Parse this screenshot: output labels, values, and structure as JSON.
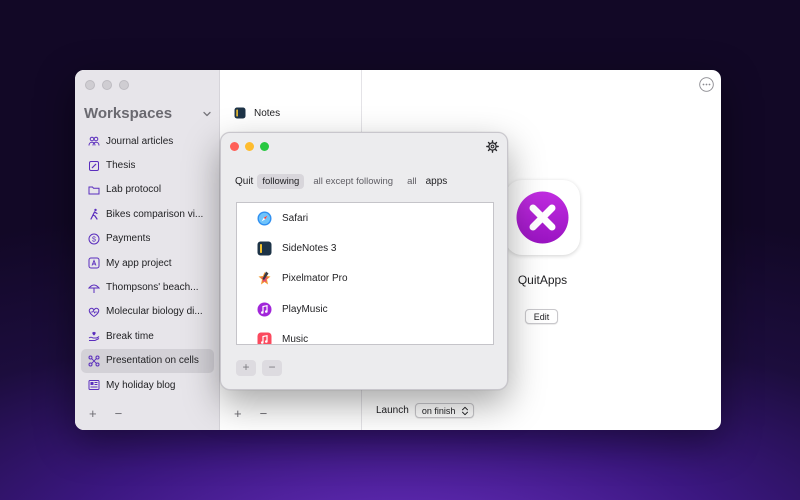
{
  "sidebar": {
    "title": "Workspaces",
    "items": [
      {
        "label": "Journal articles",
        "icon": "people-icon"
      },
      {
        "label": "Thesis",
        "icon": "pencil-square-icon"
      },
      {
        "label": "Lab protocol",
        "icon": "folder-icon"
      },
      {
        "label": "Bikes comparison vi...",
        "icon": "cyclist-icon"
      },
      {
        "label": "Payments",
        "icon": "dollar-circle-icon"
      },
      {
        "label": "My app project",
        "icon": "app-store-icon"
      },
      {
        "label": "Thompsons' beach...",
        "icon": "beach-umbrella-icon"
      },
      {
        "label": "Molecular biology di...",
        "icon": "heart-pulse-icon"
      },
      {
        "label": "Break time",
        "icon": "hand-heart-icon"
      },
      {
        "label": "Presentation on cells",
        "icon": "network-icon",
        "selected": true
      },
      {
        "label": "My holiday blog",
        "icon": "newspaper-icon"
      }
    ],
    "add_label": "+",
    "remove_label": "−"
  },
  "middle": {
    "notes_label": "Notes",
    "add_label": "+",
    "remove_label": "−"
  },
  "detail": {
    "app_name": "QuitApps",
    "edit_label": "Edit",
    "launch_label": "Launch",
    "launch_value": "on finish"
  },
  "popover": {
    "quit_label": "Quit",
    "segments": [
      "following",
      "all except following",
      "all"
    ],
    "apps_label": "apps",
    "apps": [
      {
        "name": "Safari",
        "icon": "safari-icon"
      },
      {
        "name": "SideNotes 3",
        "icon": "sidenotes-icon"
      },
      {
        "name": "Pixelmator Pro",
        "icon": "pixelmator-icon"
      },
      {
        "name": "PlayMusic",
        "icon": "playmusic-icon"
      },
      {
        "name": "Music",
        "icon": "music-icon"
      }
    ],
    "add_label": "+",
    "remove_label": "−"
  },
  "colors": {
    "close": "#ff5f57",
    "minimize": "#febc2e",
    "zoom": "#28c840",
    "quitapps_purple": "#b21fd6"
  }
}
